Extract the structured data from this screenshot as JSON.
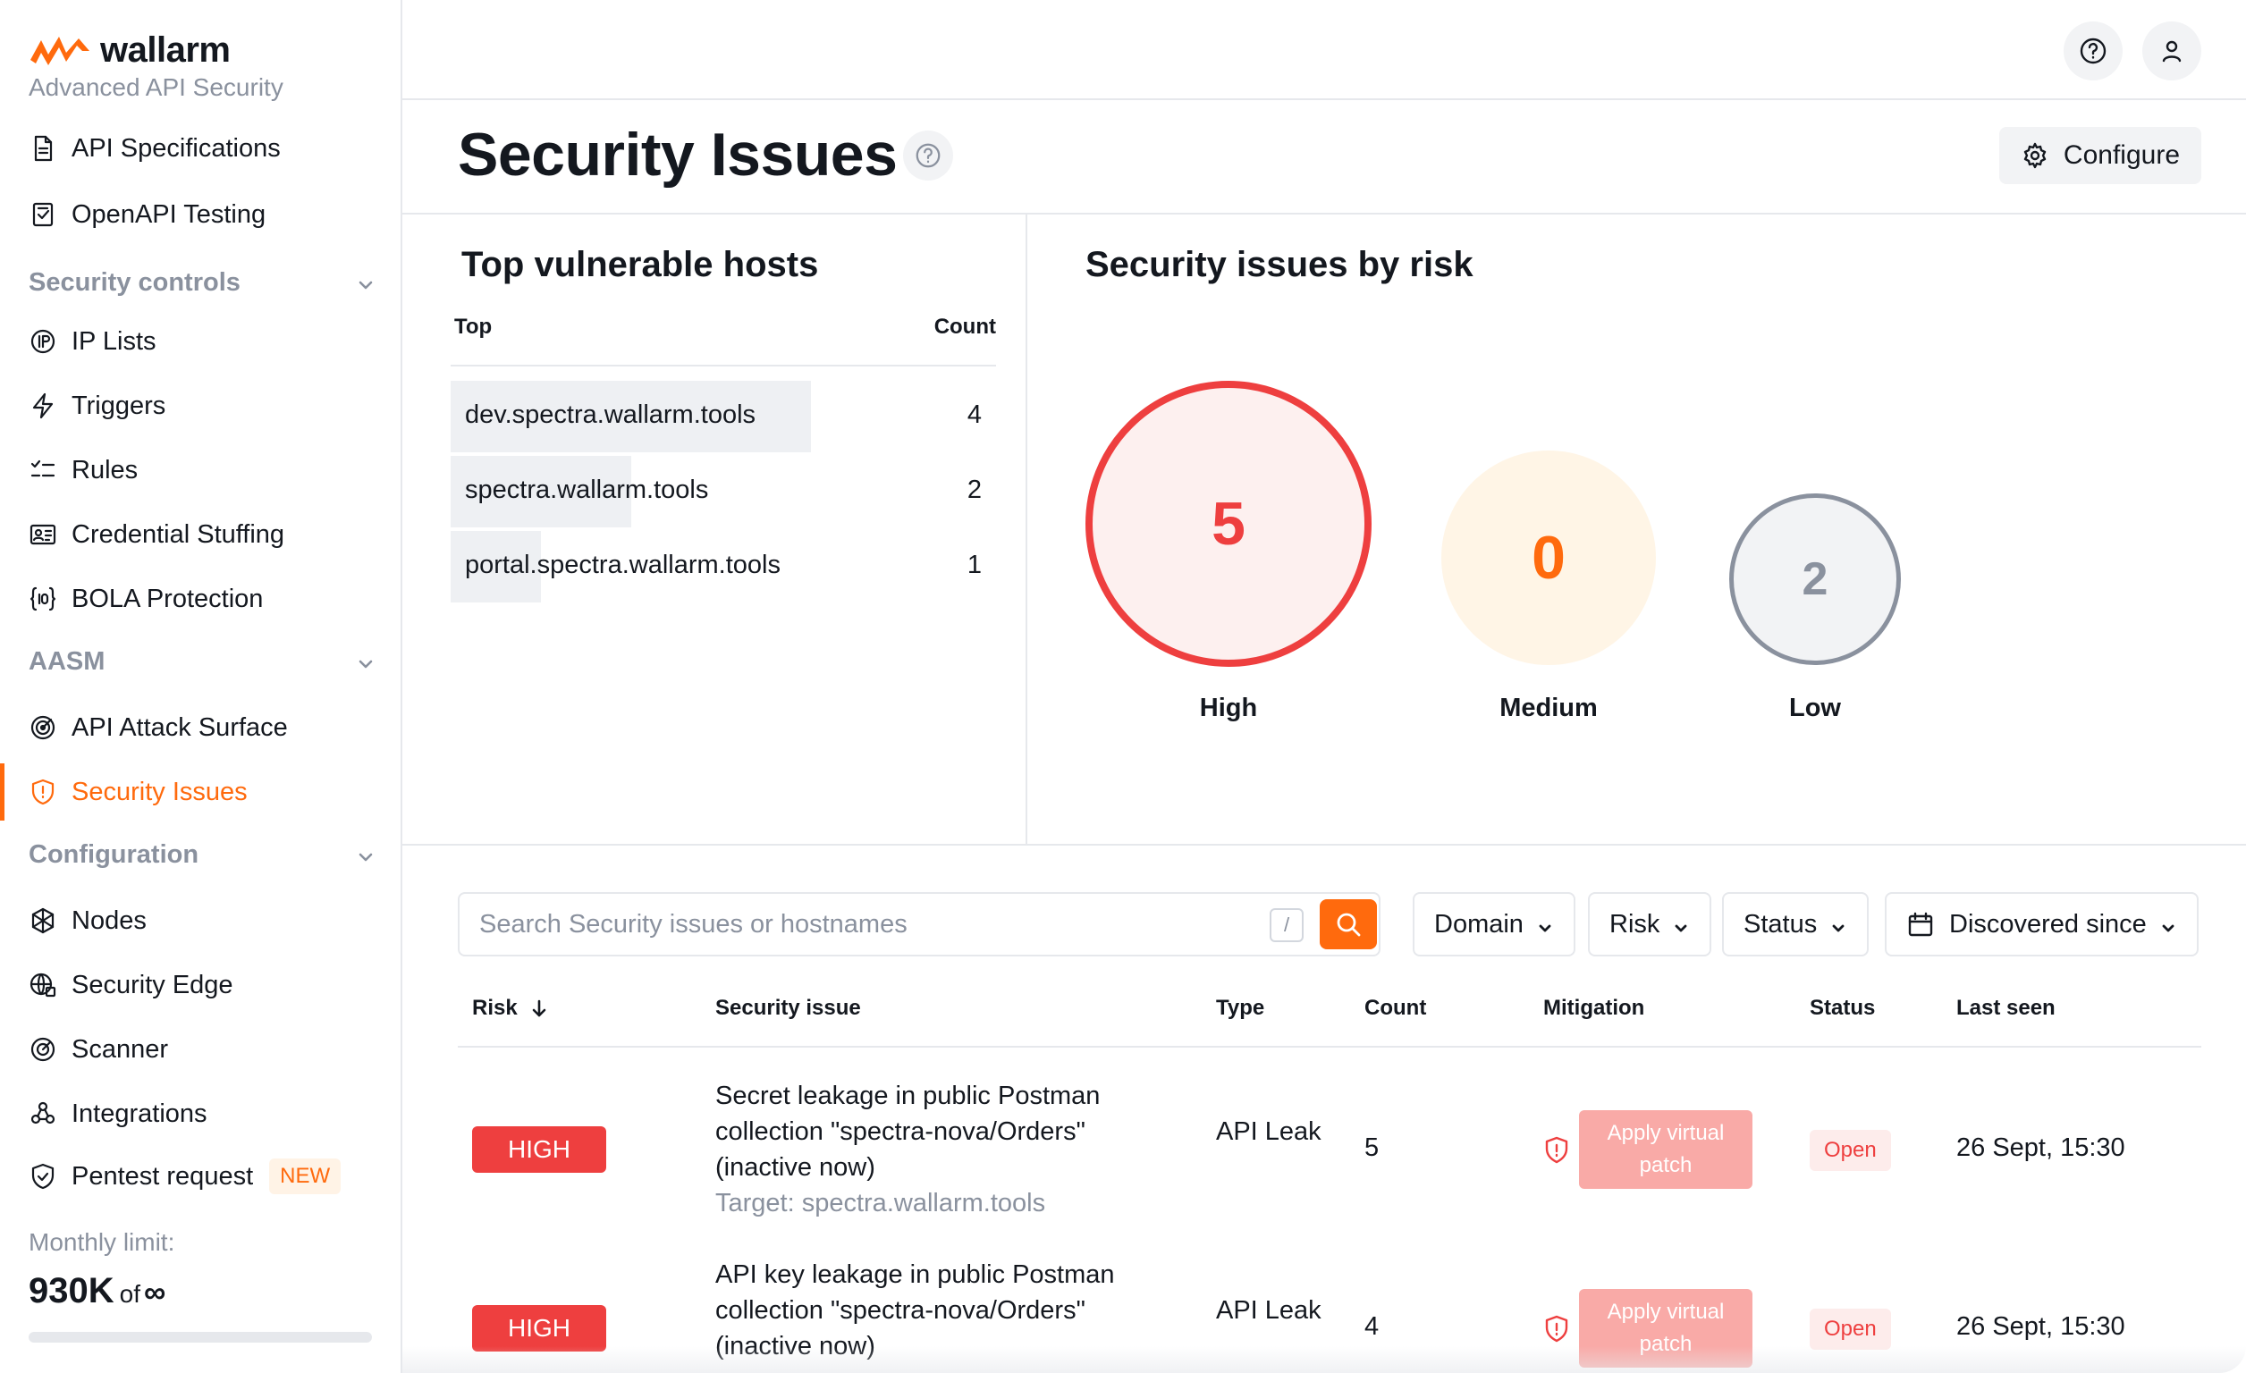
{
  "brand": {
    "name": "wallarm",
    "tagline": "Advanced API Security",
    "accent": "#ff6a0d"
  },
  "sidebar": {
    "items": [
      {
        "label": "API Specifications",
        "icon": "document-icon"
      },
      {
        "label": "OpenAPI Testing",
        "icon": "checklist-icon"
      },
      {
        "section": "Security controls"
      },
      {
        "label": "IP Lists",
        "icon": "ip-icon"
      },
      {
        "label": "Triggers",
        "icon": "lightning-icon"
      },
      {
        "label": "Rules",
        "icon": "rules-icon"
      },
      {
        "label": "Credential Stuffing",
        "icon": "id-card-icon"
      },
      {
        "label": "BOLA Protection",
        "icon": "bola-icon"
      },
      {
        "section": "AASM"
      },
      {
        "label": "API Attack Surface",
        "icon": "radar-icon"
      },
      {
        "label": "Security Issues",
        "icon": "shield-icon",
        "active": true
      },
      {
        "section": "Configuration"
      },
      {
        "label": "Nodes",
        "icon": "nodes-icon"
      },
      {
        "label": "Security Edge",
        "icon": "globe-icon"
      },
      {
        "label": "Scanner",
        "icon": "scanner-icon"
      },
      {
        "label": "Integrations",
        "icon": "integrations-icon"
      },
      {
        "label": "Pentest request",
        "icon": "pentest-shield-icon",
        "badge": "NEW"
      }
    ],
    "monthly_limit": {
      "label": "Monthly limit:",
      "value": "930K",
      "of": "of",
      "total": "∞"
    }
  },
  "page": {
    "title": "Security Issues",
    "configure_label": "Configure"
  },
  "hosts_widget": {
    "title": "Top vulnerable hosts",
    "col_top": "Top",
    "col_count": "Count",
    "rows": [
      {
        "host": "dev.spectra.wallarm.tools",
        "count": "4"
      },
      {
        "host": "spectra.wallarm.tools",
        "count": "2"
      },
      {
        "host": "portal.spectra.wallarm.tools",
        "count": "1"
      }
    ]
  },
  "risk_widget": {
    "title": "Security issues by risk",
    "high": {
      "label": "High",
      "value": "5",
      "color": "#ee3f3f"
    },
    "medium": {
      "label": "Medium",
      "value": "0",
      "color": "#ff6a0d"
    },
    "low": {
      "label": "Low",
      "value": "2",
      "color": "#8a919e"
    }
  },
  "filters": {
    "search_placeholder": "Search Security issues or hostnames",
    "search_value": "",
    "shortcut": "/",
    "domain": "Domain",
    "risk": "Risk",
    "status": "Status",
    "discovered": "Discovered since"
  },
  "table": {
    "headers": {
      "risk": "Risk",
      "issue": "Security issue",
      "type": "Type",
      "count": "Count",
      "mitigation": "Mitigation",
      "status": "Status",
      "last_seen": "Last seen"
    },
    "rows": [
      {
        "risk": "HIGH",
        "issue": "Secret leakage in public Postman collection \"spectra-nova/Orders\" (inactive now)",
        "target": "Target: spectra.wallarm.tools",
        "type": "API Leak",
        "count": "5",
        "mitigation": "Apply virtual patch",
        "status": "Open",
        "last_seen": "26 Sept, 15:30"
      },
      {
        "risk": "HIGH",
        "issue": "API key leakage in public Postman collection \"spectra-nova/Orders\" (inactive now)",
        "target": "",
        "type": "API Leak",
        "count": "4",
        "mitigation": "Apply virtual patch",
        "status": "Open",
        "last_seen": "26 Sept, 15:30"
      }
    ]
  }
}
